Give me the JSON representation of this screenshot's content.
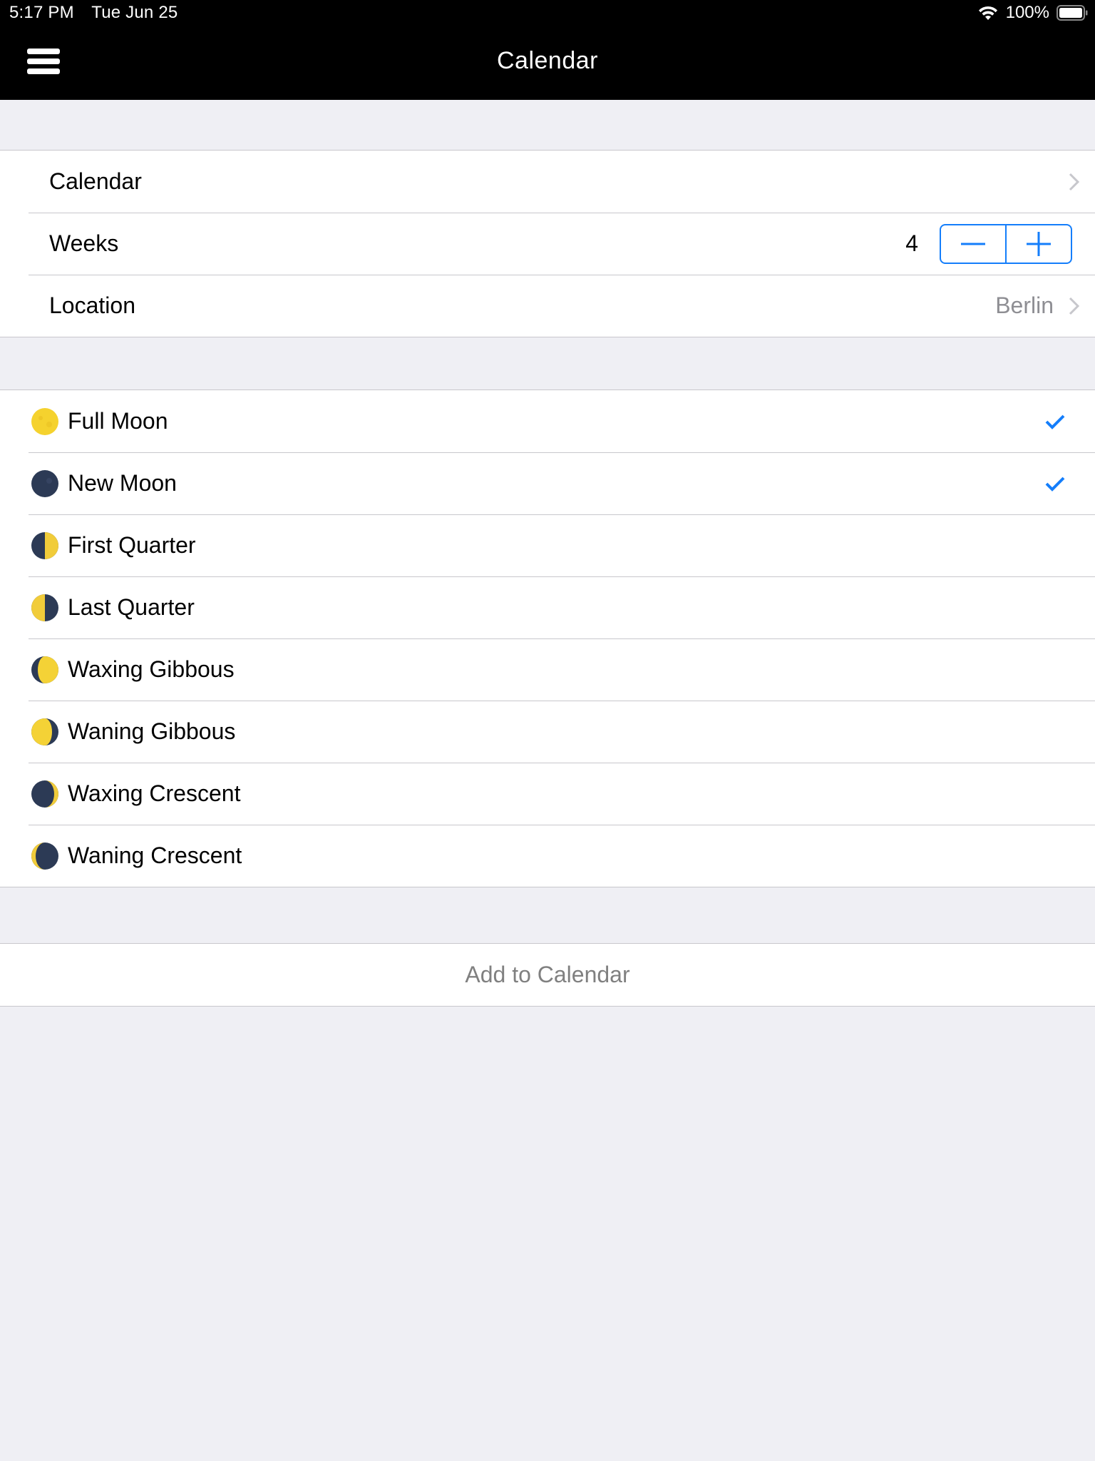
{
  "status_bar": {
    "time": "5:17 PM",
    "date": "Tue Jun 25",
    "battery": "100%",
    "icons": [
      "wifi-icon",
      "battery-icon"
    ]
  },
  "nav": {
    "title": "Calendar",
    "left_icon": "hamburger-menu-icon"
  },
  "settings": {
    "calendar_label": "Calendar",
    "weeks_label": "Weeks",
    "weeks_value": "4",
    "stepper_minus": "minus-icon",
    "stepper_plus": "plus-icon",
    "location_label": "Location",
    "location_value": "Berlin"
  },
  "phases": [
    {
      "label": "Full Moon",
      "icon": "full-moon-icon",
      "checked": true
    },
    {
      "label": "New Moon",
      "icon": "new-moon-icon",
      "checked": true
    },
    {
      "label": "First Quarter",
      "icon": "first-quarter-moon-icon",
      "checked": false
    },
    {
      "label": "Last Quarter",
      "icon": "last-quarter-moon-icon",
      "checked": false
    },
    {
      "label": "Waxing Gibbous",
      "icon": "waxing-gibbous-moon-icon",
      "checked": false
    },
    {
      "label": "Waning Gibbous",
      "icon": "waning-gibbous-moon-icon",
      "checked": false
    },
    {
      "label": "Waxing Crescent",
      "icon": "waxing-crescent-moon-icon",
      "checked": false
    },
    {
      "label": "Waning Crescent",
      "icon": "waning-crescent-moon-icon",
      "checked": false
    }
  ],
  "actions": {
    "add_to_calendar": "Add to Calendar"
  },
  "colors": {
    "accent": "#147efb",
    "moon_light": "#f7d631",
    "moon_dark": "#2c3a55",
    "background": "#efeff4",
    "secondary_text": "#8e8e93"
  }
}
